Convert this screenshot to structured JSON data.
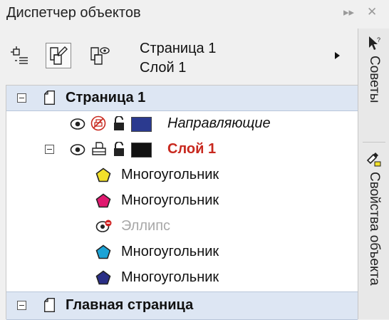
{
  "title": "Диспетчер объектов",
  "toolbar": {
    "breadcrumb_page": "Страница 1",
    "breadcrumb_layer": "Слой 1"
  },
  "tree": {
    "page1": {
      "label": "Страница 1",
      "guides": {
        "label": "Направляющие",
        "color": "#2b3a8f"
      },
      "layer1": {
        "label": "Слой 1",
        "color": "#111111",
        "items": [
          {
            "label": "Многоугольник",
            "color": "#f2e02a",
            "kind": "polygon"
          },
          {
            "label": "Многоугольник",
            "color": "#e0186f",
            "kind": "polygon"
          },
          {
            "label": "Эллипс",
            "color": "#a8a8a8",
            "kind": "ellipse"
          },
          {
            "label": "Многоугольник",
            "color": "#1ba3d6",
            "kind": "polygon"
          },
          {
            "label": "Многоугольник",
            "color": "#2a2f86",
            "kind": "polygon"
          }
        ]
      }
    },
    "master_page": {
      "label": "Главная страница"
    }
  },
  "side_tabs": {
    "tips": "Советы",
    "properties": "Свойства объекта"
  }
}
